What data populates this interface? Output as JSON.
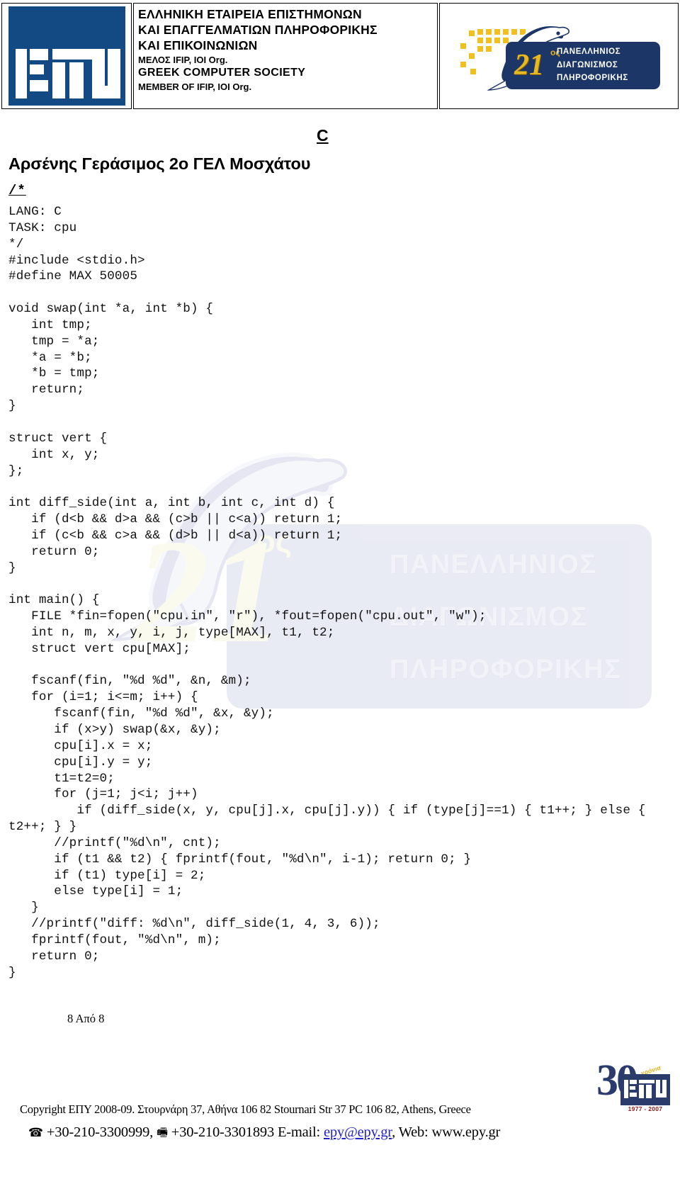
{
  "header": {
    "logo_alt": "epy-logo",
    "society_lines": [
      "ΕΛΛΗΝΙΚΗ  ΕΤΑΙΡΕΙΑ  ΕΠΙΣΤΗΜΟΝΩΝ",
      "ΚΑΙ ΕΠΑΓΓΕΛΜΑΤΙΩΝ  ΠΛΗΡΟΦΟΡΙΚΗΣ",
      "ΚΑΙ ΕΠΙΚΟΙΝΩΝΙΩΝ",
      "ΜΕΛΟΣ IFIP, IOI Org.",
      "GREEK COMPUTER SOCIETY",
      "MEMBER OF IFIP, IOI Org."
    ],
    "badge": {
      "number": "21",
      "ordinal": "ος",
      "line1": "ΠΑΝΕΛΛΗΝΙΟΣ",
      "line2": "ΔΙΑΓΩΝΙΣΜΟΣ",
      "line3": "ΠΛΗΡΟΦΟΡΙΚΗΣ"
    }
  },
  "watermark": {
    "number": "21",
    "ordinal": "ος",
    "line1": "ΠΑΝΕΛΛΗΝΙΟΣ",
    "line2": "ΔΙΑΓΩΝΙΣΜΟΣ",
    "line3": "ΠΛΗΡΟΦΟΡΙΚΗΣ"
  },
  "document": {
    "language_tag": "C",
    "title": "Αρσένης Γεράσιμος 2ο ΓΕΛ Μοσχάτου",
    "comment_open": "/*",
    "page_number": "8 Από 8",
    "code": "LANG: C\nTASK: cpu\n*/\n#include <stdio.h>\n#define MAX 50005\n\nvoid swap(int *a, int *b) {\n   int tmp;\n   tmp = *a;\n   *a = *b;\n   *b = tmp;\n   return;\n}\n\nstruct vert {\n   int x, y;\n};\n\nint diff_side(int a, int b, int c, int d) {\n   if (d<b && d>a && (c>b || c<a)) return 1;\n   if (c<b && c>a && (d>b || d<a)) return 1;\n   return 0;\n}\n\nint main() {\n   FILE *fin=fopen(\"cpu.in\", \"r\"), *fout=fopen(\"cpu.out\", \"w\");\n   int n, m, x, y, i, j, type[MAX], t1, t2;\n   struct vert cpu[MAX];\n\n   fscanf(fin, \"%d %d\", &n, &m);\n   for (i=1; i<=m; i++) {\n      fscanf(fin, \"%d %d\", &x, &y);\n      if (x>y) swap(&x, &y);\n      cpu[i].x = x;\n      cpu[i].y = y;\n      t1=t2=0;\n      for (j=1; j<i; j++)\n         if (diff_side(x, y, cpu[j].x, cpu[j].y)) { if (type[j]==1) { t1++; } else { t2++; } }\n      //printf(\"%d\\n\", cnt);\n      if (t1 && t2) { fprintf(fout, \"%d\\n\", i-1); return 0; }\n      if (t1) type[i] = 2;\n      else type[i] = 1;\n   }\n   //printf(\"diff: %d\\n\", diff_side(1, 4, 3, 6));\n   fprintf(fout, \"%d\\n\", m);\n   return 0;\n}"
  },
  "footer": {
    "anniversary": {
      "number": "30",
      "word": "χρόνια",
      "years": "1977 - 2007"
    },
    "copyright": "Copyright ΕΠΥ 2008-09. Στουρνάρη 37, Αθήνα 106 82 Stournari Str 37 PC 106 82, Athens, Greece",
    "phone_icon": "☎",
    "phone": "+30-210-3300999,",
    "fax_icon": "🖷",
    "fax": "+30-210-3301893",
    "email_label": "E-mail:",
    "email": "epy@epy.gr",
    "web_label": ", Web:",
    "web": "www.epy.gr"
  }
}
